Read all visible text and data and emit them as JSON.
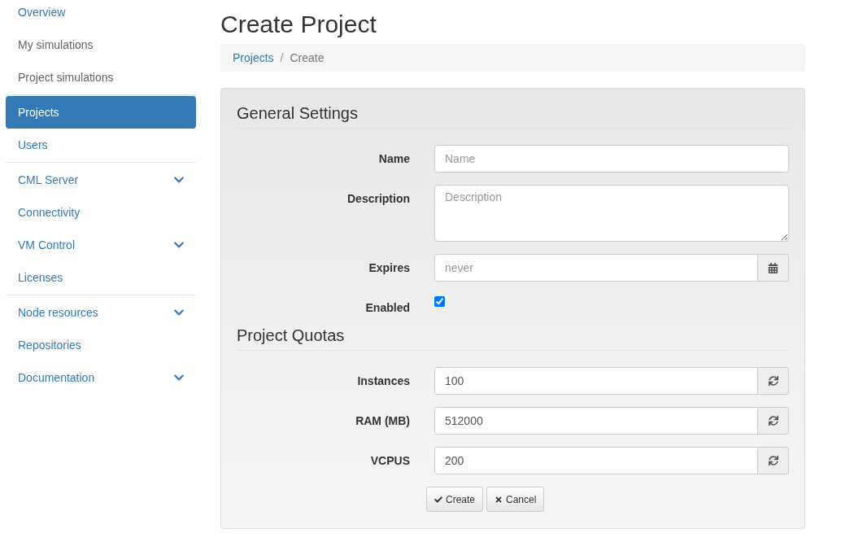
{
  "sidebar": {
    "groups": [
      {
        "items": [
          {
            "label": "Overview",
            "muted": false,
            "selected": false,
            "expandable": false
          },
          {
            "label": "My simulations",
            "muted": true,
            "selected": false,
            "expandable": false
          },
          {
            "label": "Project simulations",
            "muted": true,
            "selected": false,
            "expandable": false
          }
        ]
      },
      {
        "items": [
          {
            "label": "Projects",
            "muted": false,
            "selected": true,
            "expandable": false
          },
          {
            "label": "Users",
            "muted": false,
            "selected": false,
            "expandable": false
          }
        ]
      },
      {
        "items": [
          {
            "label": "CML Server",
            "muted": false,
            "selected": false,
            "expandable": true
          },
          {
            "label": "Connectivity",
            "muted": false,
            "selected": false,
            "expandable": false
          },
          {
            "label": "VM Control",
            "muted": false,
            "selected": false,
            "expandable": true
          },
          {
            "label": "Licenses",
            "muted": false,
            "selected": false,
            "expandable": false
          }
        ]
      },
      {
        "items": [
          {
            "label": "Node resources",
            "muted": false,
            "selected": false,
            "expandable": true
          },
          {
            "label": "Repositories",
            "muted": false,
            "selected": false,
            "expandable": false
          },
          {
            "label": "Documentation",
            "muted": false,
            "selected": false,
            "expandable": true
          }
        ]
      }
    ]
  },
  "page_title": "Create Project",
  "breadcrumb": [
    {
      "label": "Projects",
      "kind": "link"
    },
    {
      "separator": "/",
      "label": "Create",
      "kind": "current"
    }
  ],
  "sections": [
    {
      "title": "General Settings",
      "fields": [
        {
          "kind": "text",
          "label": "Name",
          "placeholder": "Name"
        },
        {
          "kind": "textarea",
          "label": "Description",
          "placeholder": "Description"
        },
        {
          "kind": "date",
          "label": "Expires",
          "placeholder": "never"
        },
        {
          "kind": "checkbox",
          "label": "Enabled",
          "checked": true
        }
      ]
    },
    {
      "title": "Project Quotas",
      "fields": [
        {
          "kind": "reset",
          "label": "Instances",
          "value": "100"
        },
        {
          "kind": "reset",
          "label": "RAM (MB)",
          "value": "512000"
        },
        {
          "kind": "reset",
          "label": "VCPUS",
          "value": "200"
        }
      ]
    }
  ],
  "buttons": [
    {
      "kind": "submit",
      "label": "Create"
    },
    {
      "kind": "cancel",
      "label": "Cancel"
    }
  ]
}
